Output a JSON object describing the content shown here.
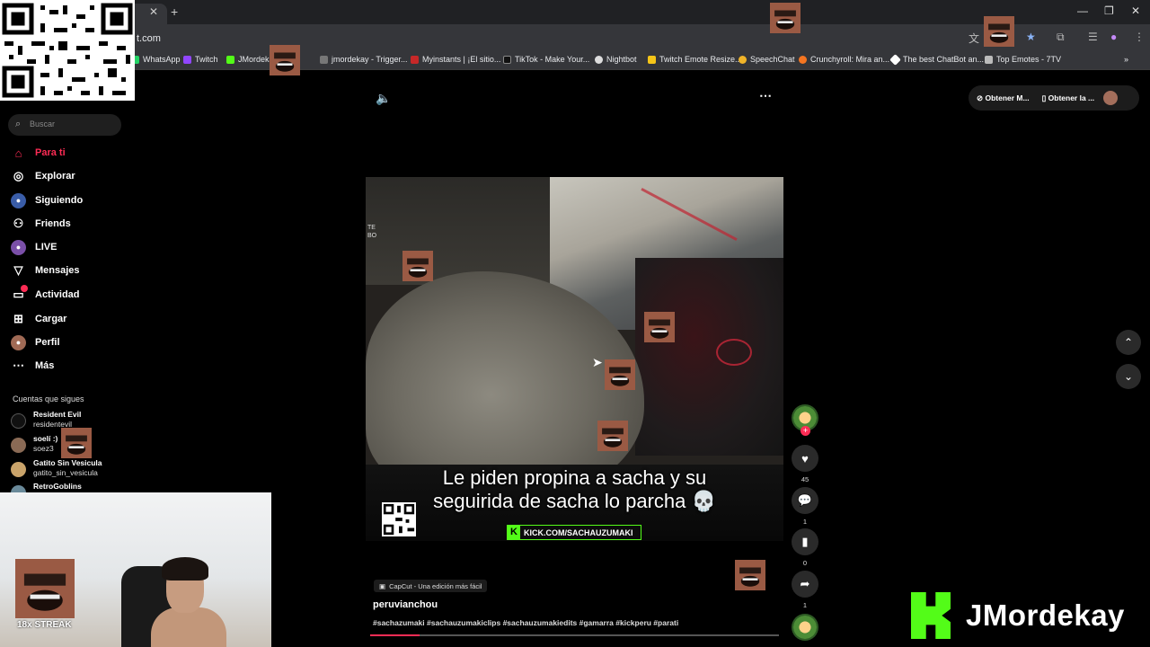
{
  "browser": {
    "url": "t.com",
    "bookmarks": [
      "WhatsApp",
      "Twitch",
      "JMordekay",
      "jmordekay - Trigger...",
      "Myinstants | ¡El sitio...",
      "TikTok - Make Your...",
      "Nightbot",
      "Twitch Emote Resize...",
      "SpeechChat",
      "Crunchyroll: Mira an...",
      "The best ChatBot an...",
      "Top Emotes - 7TV"
    ]
  },
  "sidebar": {
    "search_placeholder": "Buscar",
    "nav": [
      "Para ti",
      "Explorar",
      "Siguiendo",
      "Friends",
      "LIVE",
      "Mensajes",
      "Actividad",
      "Cargar",
      "Perfil",
      "Más"
    ],
    "following_header": "Cuentas que sigues",
    "accounts": [
      {
        "name": "Resident Evil",
        "handle": "residentevil"
      },
      {
        "name": "soelí :)",
        "handle": "soez3"
      },
      {
        "name": "Gatito Sin Vesicula",
        "handle": "gatito_sin_vesicula"
      },
      {
        "name": "RetroGoblins",
        "handle": ""
      }
    ]
  },
  "topright": {
    "btn1": "Obtener M...",
    "btn2": "Obtener la ..."
  },
  "video": {
    "watermark": "TE\nBO",
    "caption_line1": "Le piden propina a sacha y su",
    "caption_line2": "seguirida de sacha lo parcha 💀",
    "banner": "KICK.COM/SACHAUZUMAKI",
    "progress": 0.12
  },
  "actions": {
    "likes": "45",
    "comments": "1",
    "saves": "0",
    "shares": "1"
  },
  "post": {
    "capcut": "CapCut - Una edición más fácil",
    "username": "peruvianchou",
    "hashtags": "#sachazumaki #sachauzumakiclips #sachauzumakiedits #gamarra #kickperu #parati"
  },
  "overlay": {
    "streak": "18x STREAK",
    "brand": "JMordekay"
  },
  "colors": {
    "accent": "#fe2c55",
    "kick": "#53fc18"
  }
}
